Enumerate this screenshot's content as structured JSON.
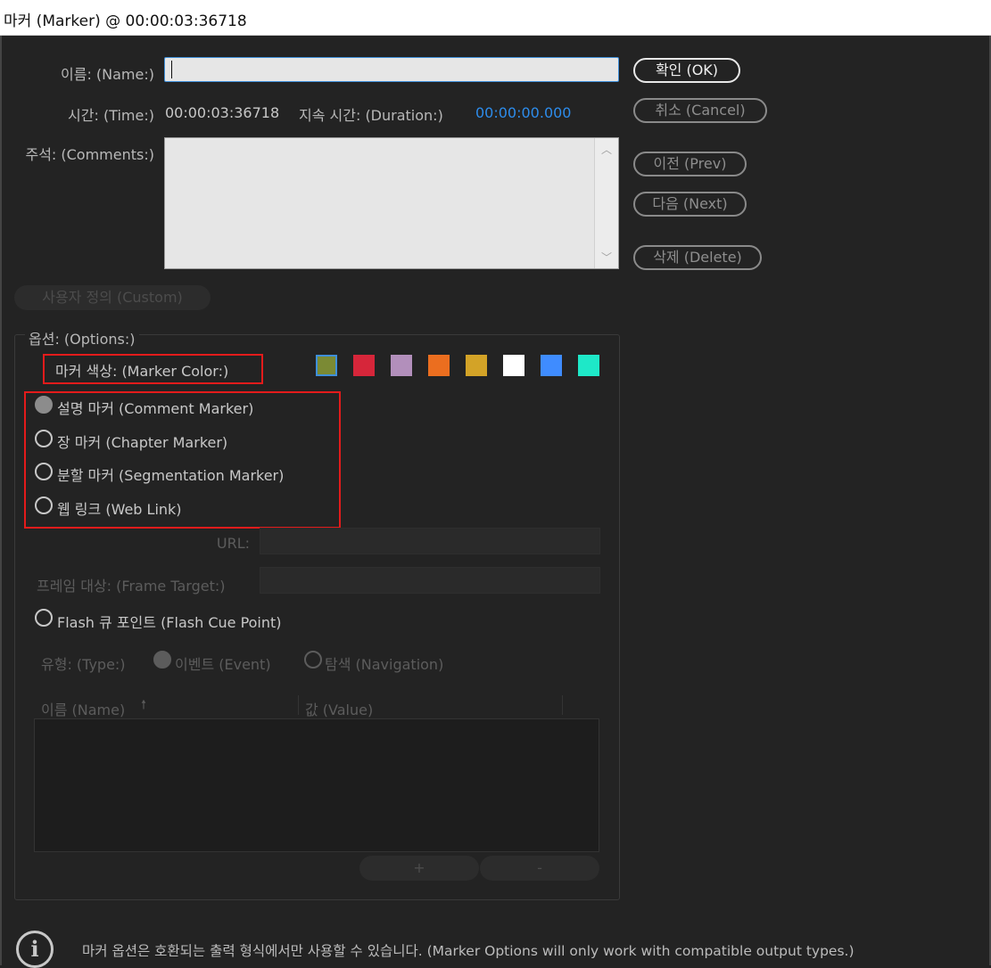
{
  "window": {
    "title": "마커 (Marker) @ 00:00:03:36718"
  },
  "form": {
    "name_label": "이름: (Name:)",
    "name_value": "",
    "time_label": "시간: (Time:)",
    "time_value": "00:00:03:36718",
    "duration_label": "지속 시간: (Duration:)",
    "duration_value": "00:00:00.000",
    "comments_label": "주석: (Comments:)",
    "comments_value": ""
  },
  "buttons": {
    "ok": "확인 (OK)",
    "cancel": "취소 (Cancel)",
    "prev": "이전 (Prev)",
    "next": "다음 (Next)",
    "delete": "삭제 (Delete)",
    "custom": "사용자 정의 (Custom)",
    "add": "+",
    "remove": "-"
  },
  "options": {
    "title": "옵션: (Options:)",
    "marker_color_label": "마커 색상: (Marker Color:)",
    "colors": [
      "#7b8a34",
      "#d6263a",
      "#b28fbb",
      "#eb6e1f",
      "#d3a327",
      "#ffffff",
      "#3f8cff",
      "#1ee8c8"
    ],
    "selected_color_index": 0,
    "marker_types": [
      {
        "label": "설명 마커 (Comment Marker)",
        "checked": true
      },
      {
        "label": "장 마커 (Chapter Marker)",
        "checked": false
      },
      {
        "label": "분할 마커 (Segmentation Marker)",
        "checked": false
      },
      {
        "label": "웹 링크 (Web Link)",
        "checked": false
      }
    ],
    "url_label": "URL:",
    "frame_target_label": "프레임 대상: (Frame Target:)",
    "flash_cue_label": "Flash 큐 포인트 (Flash Cue Point)",
    "type_label": "유형: (Type:)",
    "event_label": "이벤트 (Event)",
    "navigation_label": "탐색 (Navigation)",
    "table_name_header": "이름 (Name)",
    "table_value_header": "값 (Value)",
    "sort_icon": "arrow-up"
  },
  "footer": {
    "info_icon": "i",
    "note": "마커 옵션은 호환되는 출력 형식에서만 사용할 수 있습니다. (Marker Options will only work with compatible output types.)"
  }
}
